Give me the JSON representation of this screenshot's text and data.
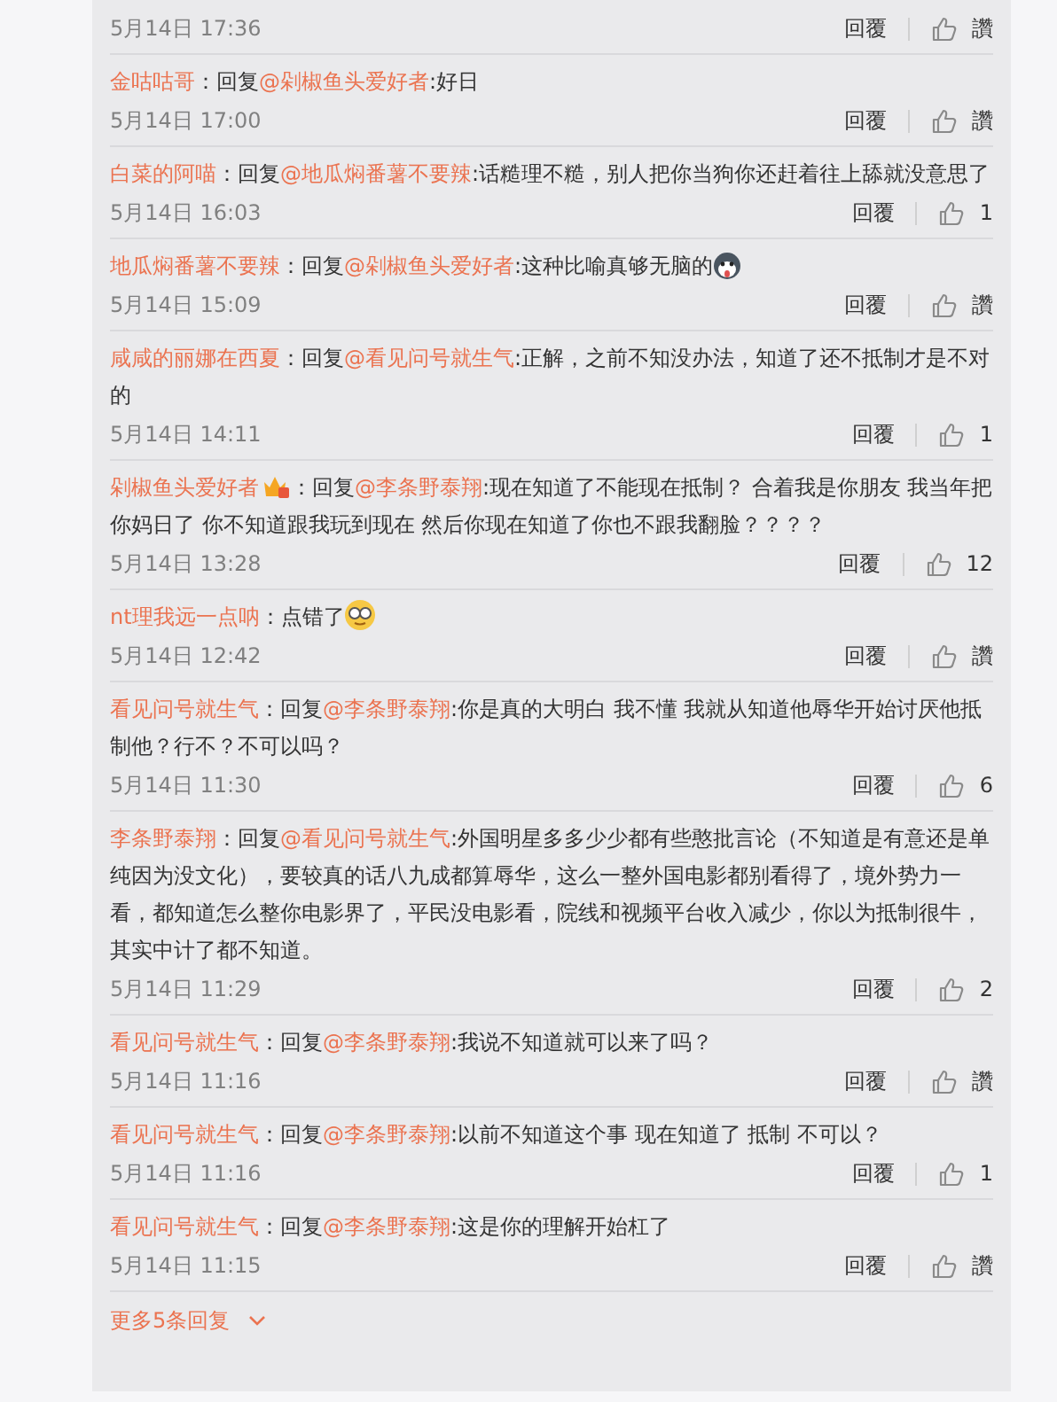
{
  "comments": [
    {
      "time": "5月14日 17:36",
      "reply_label": "回覆",
      "like_label": "讚"
    },
    {
      "user": "金咕咕哥",
      "prefix": "：回复",
      "reply_to": "@剁椒鱼头爱好者",
      "text": ":好日",
      "time": "5月14日 17:00",
      "reply_label": "回覆",
      "like_label": "讚"
    },
    {
      "user": "白菜的阿喵",
      "prefix": "：回复",
      "reply_to": "@地瓜焖番薯不要辣",
      "text": ":话糙理不糙，别人把你当狗你还赶着往上舔就没意思了",
      "time": "5月14日 16:03",
      "reply_label": "回覆",
      "like_label": "1"
    },
    {
      "user": "地瓜焖番薯不要辣",
      "prefix": "：回复",
      "reply_to": "@剁椒鱼头爱好者",
      "text": ":这种比喻真够无脑的",
      "emoji": {
        "kind": "dog"
      },
      "time": "5月14日 15:09",
      "reply_label": "回覆",
      "like_label": "讚"
    },
    {
      "user": "咸咸的丽娜在西夏",
      "prefix": "：回复",
      "reply_to": "@看见问号就生气",
      "text": ":正解，之前不知没办法，知道了还不抵制才是不对的",
      "time": "5月14日 14:11",
      "reply_label": "回覆",
      "like_label": "1"
    },
    {
      "user": "剁椒鱼头爱好者",
      "badge": true,
      "prefix": "：回复",
      "reply_to": "@李条野泰翔",
      "text": ":现在知道了不能现在抵制？  合着我是你朋友 我当年把你妈日了  你不知道跟我玩到现在  然后你现在知道了你也不跟我翻脸？？？？",
      "time": "5月14日 13:28",
      "reply_label": "回覆",
      "like_label": "12"
    },
    {
      "user": "nt理我远一点呐",
      "prefix": "：",
      "text": "点错了",
      "emoji": {
        "kind": "glasses"
      },
      "time": "5月14日 12:42",
      "reply_label": "回覆",
      "like_label": "讚"
    },
    {
      "user": "看见问号就生气",
      "prefix": "：回复",
      "reply_to": "@李条野泰翔",
      "text": ":你是真的大明白 我不懂 我就从知道他辱华开始讨厌他抵制他？行不？不可以吗？",
      "time": "5月14日 11:30",
      "reply_label": "回覆",
      "like_label": "6"
    },
    {
      "user": "李条野泰翔",
      "prefix": "：回复",
      "reply_to": "@看见问号就生气",
      "text": ":外国明星多多少少都有些憨批言论（不知道是有意还是单纯因为没文化），要较真的话八九成都算辱华，这么一整外国电影都别看得了，境外势力一看，都知道怎么整你电影界了，平民没电影看，院线和视频平台收入减少，你以为抵制很牛，其实中计了都不知道。",
      "time": "5月14日 11:29",
      "reply_label": "回覆",
      "like_label": "2"
    },
    {
      "user": "看见问号就生气",
      "prefix": "：回复",
      "reply_to": "@李条野泰翔",
      "text": ":我说不知道就可以来了吗？",
      "time": "5月14日 11:16",
      "reply_label": "回覆",
      "like_label": "讚"
    },
    {
      "user": "看见问号就生气",
      "prefix": "：回复",
      "reply_to": "@李条野泰翔",
      "text": ":以前不知道这个事 现在知道了 抵制 不可以？",
      "time": "5月14日 11:16",
      "reply_label": "回覆",
      "like_label": "1"
    },
    {
      "user": "看见问号就生气",
      "prefix": "：回复",
      "reply_to": "@李条野泰翔",
      "text": ":这是你的理解开始杠了",
      "time": "5月14日 11:15",
      "reply_label": "回覆",
      "like_label": "讚"
    }
  ],
  "more_link": "更多5条回复"
}
